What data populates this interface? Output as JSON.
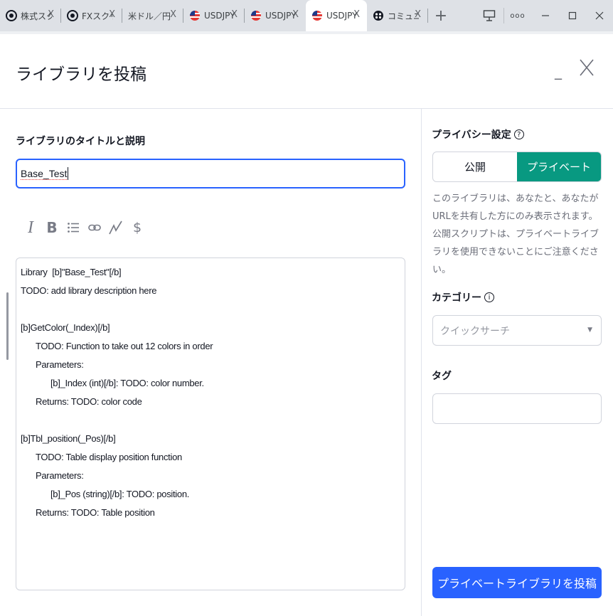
{
  "browser": {
    "tabs": [
      {
        "title": "株式スクリ",
        "icon": "tradingview-icon",
        "active": false
      },
      {
        "title": "FXスクリ",
        "icon": "tradingview-icon",
        "active": false
      },
      {
        "title": "米ドル／円",
        "icon": "none",
        "active": false
      },
      {
        "title": "USDJPY",
        "icon": "us-flag-icon",
        "active": false
      },
      {
        "title": "USDJPY",
        "icon": "us-flag-icon",
        "active": false
      },
      {
        "title": "USDJPY",
        "icon": "us-flag-icon",
        "active": true
      },
      {
        "title": "コミュニ",
        "icon": "community-icon",
        "active": false
      }
    ],
    "close_glyph": "X",
    "new_tab_glyph": "+",
    "more_glyph": "ooo"
  },
  "dialog": {
    "title": "ライブラリを投稿",
    "minimize_glyph": "_",
    "left": {
      "title_label": "ライブラリのタイトルと説明",
      "title_value": "Base_Test",
      "toolbar": [
        {
          "name": "italic-button",
          "glyph": "I"
        },
        {
          "name": "bold-button",
          "glyph": "B"
        },
        {
          "name": "list-button",
          "glyph": "list"
        },
        {
          "name": "link-button",
          "glyph": "link"
        },
        {
          "name": "chart-button",
          "glyph": "chart"
        },
        {
          "name": "symbol-button",
          "glyph": "$"
        }
      ],
      "description_lines": [
        {
          "text": "Library  [b]\"Base_Test\"[/b]",
          "indent": 0
        },
        {
          "text": "TODO: add library description here",
          "indent": 0
        },
        {
          "text": "",
          "indent": 0
        },
        {
          "text": "[b]GetColor(_Index)[/b]",
          "indent": 0
        },
        {
          "text": "TODO: Function to take out 12 colors in order",
          "indent": 1
        },
        {
          "text": "Parameters:",
          "indent": 1
        },
        {
          "text": "[b]_Index (int)[/b]: TODO: color number.",
          "indent": 2
        },
        {
          "text": "Returns: TODO: color code",
          "indent": 1
        },
        {
          "text": "",
          "indent": 0
        },
        {
          "text": "[b]Tbl_position(_Pos)[/b]",
          "indent": 0
        },
        {
          "text": "TODO: Table display position function",
          "indent": 1
        },
        {
          "text": "Parameters:",
          "indent": 1
        },
        {
          "text": "[b]_Pos (string)[/b]: TODO: position.",
          "indent": 2
        },
        {
          "text": "Returns: TODO: Table position",
          "indent": 1
        }
      ]
    },
    "right": {
      "privacy_label": "プライバシー設定",
      "help_glyph": "?",
      "public_label": "公開",
      "private_label": "プライベート",
      "privacy_note": "このライブラリは、あなたと、あなたがURLを共有した方にのみ表示されます。公開スクリプトは、プライベートライブラリを使用できないことにご注意ください。",
      "category_label": "カテゴリー",
      "category_info_glyph": "i",
      "category_placeholder": "クイックサーチ",
      "tag_label": "タグ",
      "tag_value": "",
      "submit_label": "プライベートライブラリを投稿"
    }
  },
  "colors": {
    "accent": "#2962ff",
    "private_active": "#089981",
    "border": "#d1d4dc",
    "muted_text": "#6a6d78"
  }
}
